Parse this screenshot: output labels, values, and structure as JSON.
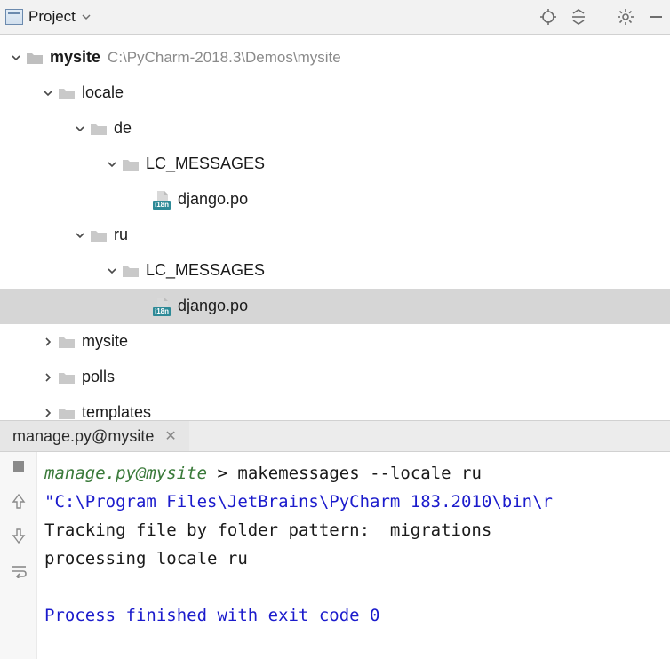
{
  "toolbar": {
    "dropdown_label": "Project"
  },
  "tree": {
    "root": {
      "name": "mysite",
      "path": "C:\\PyCharm-2018.3\\Demos\\mysite"
    },
    "locale": {
      "name": "locale"
    },
    "de": {
      "name": "de"
    },
    "de_lc": {
      "name": "LC_MESSAGES"
    },
    "de_po": {
      "name": "django.po"
    },
    "ru": {
      "name": "ru"
    },
    "ru_lc": {
      "name": "LC_MESSAGES"
    },
    "ru_po": {
      "name": "django.po"
    },
    "mysite": {
      "name": "mysite"
    },
    "polls": {
      "name": "polls"
    },
    "templates": {
      "name": "templates"
    }
  },
  "run": {
    "tab_label": "manage.py@mysite",
    "prompt_context": "manage.py@mysite",
    "prompt_sep": ">",
    "command": "makemessages --locale ru",
    "path_line": "\"C:\\Program Files\\JetBrains\\PyCharm 183.2010\\bin\\r",
    "line3": "Tracking file by folder pattern:  migrations",
    "line4": "processing locale ru",
    "line6": "Process finished with exit code 0"
  },
  "i18n_badge": "i18n"
}
